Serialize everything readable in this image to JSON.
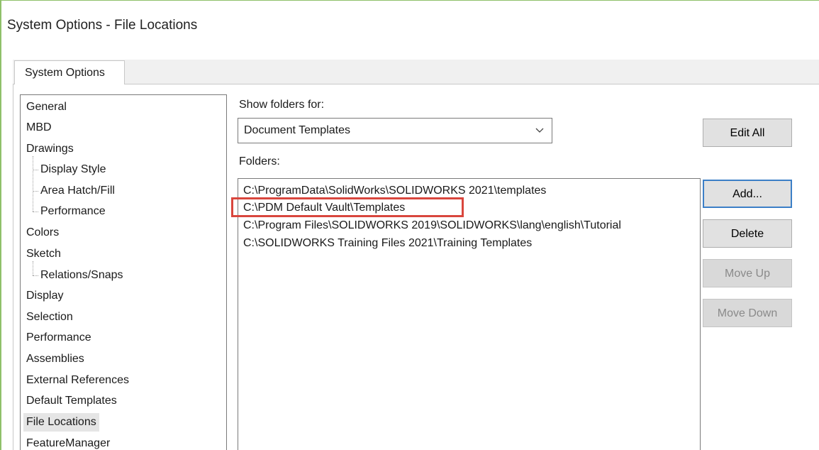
{
  "window": {
    "title": "System Options - File Locations"
  },
  "tabs": [
    {
      "label": "System Options",
      "active": true
    }
  ],
  "tree": {
    "items": [
      {
        "label": "General",
        "level": 0
      },
      {
        "label": "MBD",
        "level": 0
      },
      {
        "label": "Drawings",
        "level": 0
      },
      {
        "label": "Display Style",
        "level": 1
      },
      {
        "label": "Area Hatch/Fill",
        "level": 1
      },
      {
        "label": "Performance",
        "level": 1
      },
      {
        "label": "Colors",
        "level": 0
      },
      {
        "label": "Sketch",
        "level": 0
      },
      {
        "label": "Relations/Snaps",
        "level": 1
      },
      {
        "label": "Display",
        "level": 0
      },
      {
        "label": "Selection",
        "level": 0
      },
      {
        "label": "Performance",
        "level": 0
      },
      {
        "label": "Assemblies",
        "level": 0
      },
      {
        "label": "External References",
        "level": 0
      },
      {
        "label": "Default Templates",
        "level": 0
      },
      {
        "label": "File Locations",
        "level": 0,
        "selected": true
      },
      {
        "label": "FeatureManager",
        "level": 0
      }
    ]
  },
  "show_folders": {
    "label": "Show folders for:",
    "selected_value": "Document Templates",
    "icon": "chevron-down-icon"
  },
  "folders": {
    "label": "Folders:",
    "rows": [
      "C:\\ProgramData\\SolidWorks\\SOLIDWORKS 2021\\templates",
      "C:\\PDM Default Vault\\Templates",
      "C:\\Program Files\\SOLIDWORKS 2019\\SOLIDWORKS\\lang\\english\\Tutorial",
      "C:\\SOLIDWORKS Training Files 2021\\Training Templates"
    ],
    "highlighted_row": 1,
    "highlight_color": "#d9463d"
  },
  "buttons": {
    "edit_all": "Edit All",
    "add": "Add...",
    "delete": "Delete",
    "move_up": "Move Up",
    "move_down": "Move Down"
  },
  "colors": {
    "window_border": "#8fc06a",
    "focus_border": "#3c7fc7",
    "selection_bg": "#e5e5e5"
  }
}
